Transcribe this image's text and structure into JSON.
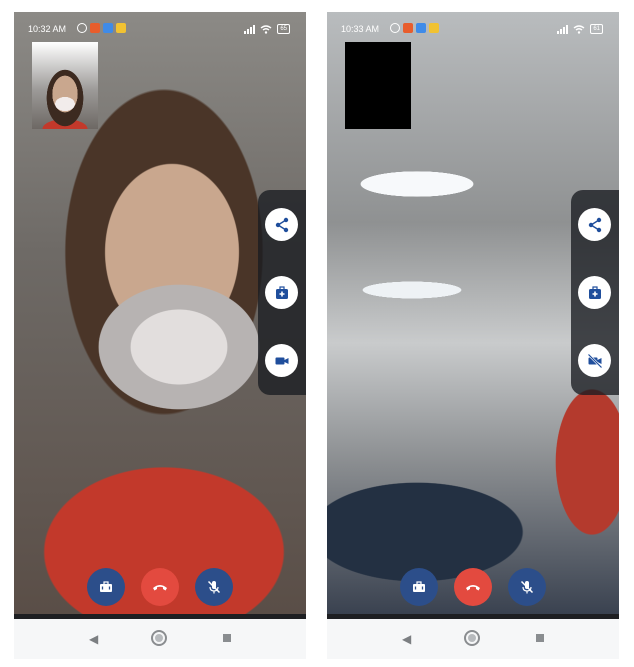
{
  "screens": [
    {
      "status": {
        "time": "10:32 AM",
        "battery": "65"
      },
      "self_view": "camera-preview",
      "side_actions": [
        "share-icon",
        "medical-kit-icon",
        "video-camera-icon"
      ],
      "bottom_controls": [
        "briefcase-icon",
        "hang-up-icon",
        "mic-off-icon"
      ]
    },
    {
      "status": {
        "time": "10:33 AM",
        "battery": "61"
      },
      "self_view": "camera-off-preview",
      "side_actions": [
        "share-icon",
        "medical-kit-icon",
        "video-camera-off-icon"
      ],
      "bottom_controls": [
        "briefcase-icon",
        "hang-up-icon",
        "mic-off-icon"
      ]
    }
  ],
  "colors": {
    "control_blue": "#2c4e8a",
    "hangup_red": "#e34a3f",
    "side_icon_blue": "#1f4e9c"
  }
}
